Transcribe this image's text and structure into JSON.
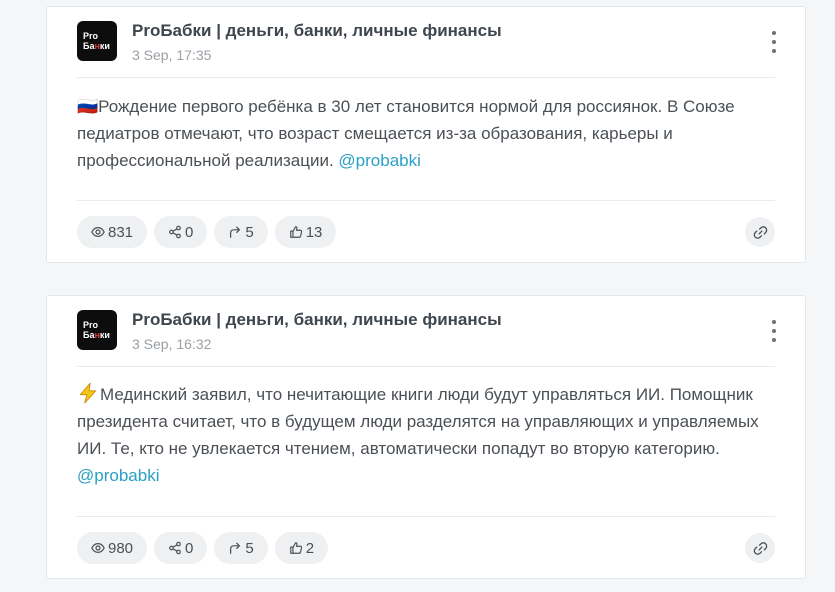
{
  "posts": [
    {
      "channel": "ProБабки | деньги, банки, личные финансы",
      "date": "3 Sep, 17:35",
      "avatar": {
        "line1": "Pro",
        "line2_a": "Ба",
        "line2_b": "н",
        "line2_c": "ки"
      },
      "text": "🇷🇺Рождение первого ребёнка в 30 лет становится нормой для россиянок. В Союзе педиатров отмечают, что возраст смещается из-за образования, карьеры и профессиональной реализации. ",
      "mention": "@probabki",
      "stats": {
        "views": "831",
        "shares": "0",
        "forwards": "5",
        "reactions": "13"
      }
    },
    {
      "channel": "ProБабки | деньги, банки, личные финансы",
      "date": "3 Sep, 16:32",
      "avatar": {
        "line1": "Pro",
        "line2_a": "Ба",
        "line2_b": "н",
        "line2_c": "ки"
      },
      "text": "Мединский заявил, что нечитающие книги люди будут управляться ИИ. Помощник президента считает, что в будущем люди разделятся на управляющих и управляемых ИИ. Те, кто не увлекается чтением, автоматически попадут во вторую категорию. ",
      "mention": "@probabki",
      "stats": {
        "views": "980",
        "shares": "0",
        "forwards": "5",
        "reactions": "2"
      }
    }
  ],
  "colors": {
    "mention": "#2aa0c5",
    "chip_bg": "#eef0f2",
    "avatar_bg": "#0d0d0d",
    "bolt": "#f5c518"
  },
  "icons": [
    "eye-icon",
    "share-icon",
    "forward-icon",
    "thumbs-up-icon",
    "link-icon",
    "more-vertical-icon",
    "lightning-icon"
  ]
}
